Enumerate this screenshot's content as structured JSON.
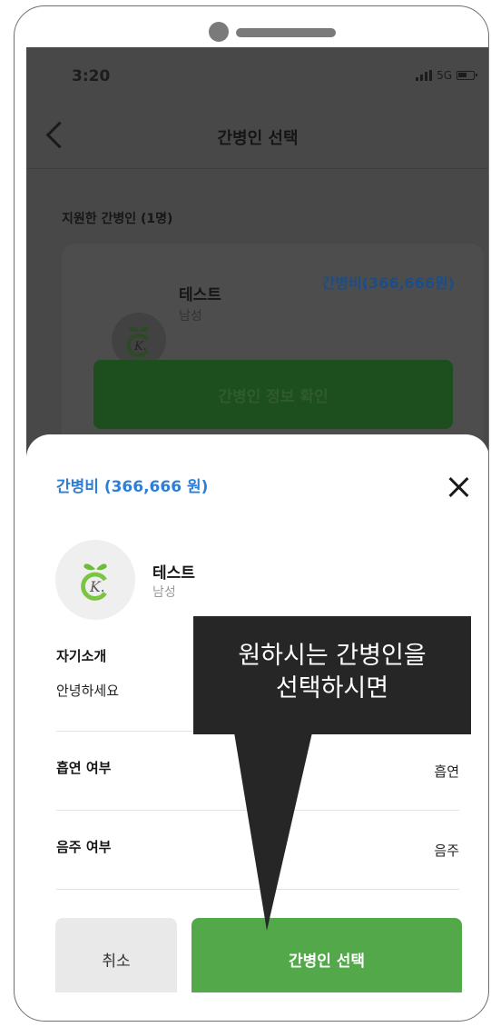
{
  "status_bar": {
    "time": "3:20",
    "network": "5G"
  },
  "header": {
    "title": "간병인 선택"
  },
  "background": {
    "section_title": "지원한 간병인 (1명)",
    "card": {
      "name": "테스트",
      "gender": "남성",
      "fee": "간병비(366,666원)",
      "info_button": "간병인 정보 확인"
    }
  },
  "sheet": {
    "fee": "간병비 (366,666 원)",
    "name": "테스트",
    "gender": "남성",
    "intro_title": "자기소개",
    "intro_text": "안녕하세요",
    "rows": [
      {
        "label": "흡연 여부",
        "value": "흡연"
      },
      {
        "label": "음주 여부",
        "value": "음주"
      }
    ],
    "cancel_button": "취소",
    "select_button": "간병인 선택"
  },
  "callout": {
    "line1": "원하시는 간병인을",
    "line2": "선택하시면"
  },
  "colors": {
    "accent_blue": "#2e7dd6",
    "primary_green": "#53a84a",
    "overlay": "#484848",
    "callout_bg": "#262626"
  },
  "icons": [
    "back-icon",
    "close-icon",
    "logo-icon",
    "signal-icon",
    "battery-icon"
  ]
}
